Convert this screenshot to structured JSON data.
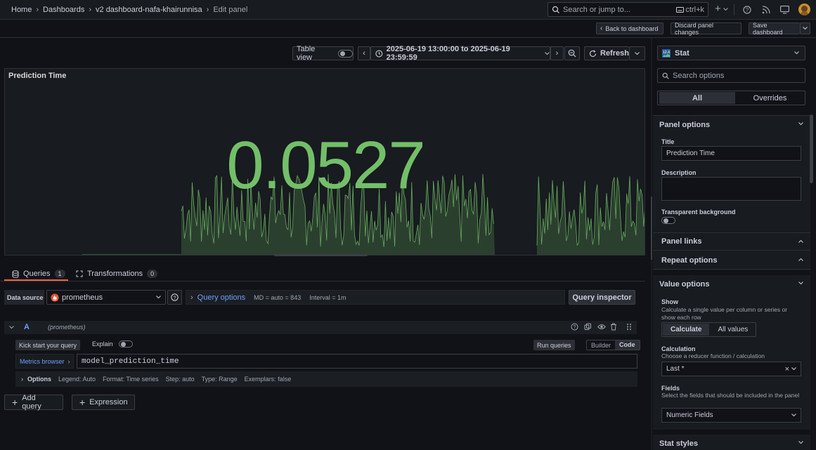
{
  "breadcrumbs": [
    "Home",
    "Dashboards",
    "v2 dashboard-nafa-khairunnisa",
    "Edit panel"
  ],
  "search": {
    "placeholder": "Search or jump to...",
    "shortcut": "ctrl+k"
  },
  "edit_toolbar": {
    "back": "Back to dashboard",
    "discard": "Discard panel changes",
    "save": "Save dashboard"
  },
  "panel_toolbar": {
    "table_view": "Table view",
    "time_range": "2025-06-19 13:00:00 to 2025-06-19 23:59:59",
    "refresh": "Refresh"
  },
  "panel": {
    "title": "Prediction Time",
    "value": "0.0527",
    "color": "#73bf69"
  },
  "query_tabs": [
    {
      "label": "Queries",
      "count": "1"
    },
    {
      "label": "Transformations",
      "count": "0"
    }
  ],
  "datasource": {
    "label": "Data source",
    "name": "prometheus",
    "query_options": "Query options",
    "md": "MD = auto = 843",
    "interval": "Interval = 1m",
    "inspector": "Query inspector"
  },
  "query": {
    "ref": "A",
    "ds": "(prometheus)",
    "kickstart": "Kick start your query",
    "explain": "Explain",
    "run": "Run queries",
    "builder": "Builder",
    "code": "Code",
    "metrics_browser": "Metrics browser",
    "expr": "model_prediction_time",
    "options": "Options",
    "legend": "Legend: Auto",
    "format": "Format: Time series",
    "step": "Step: auto",
    "type": "Type: Range",
    "exemplars": "Exemplars: false"
  },
  "add_buttons": {
    "add_query": "Add query",
    "expression": "Expression"
  },
  "right_pane": {
    "viz": "Stat",
    "search_placeholder": "Search options",
    "tabs": [
      "All",
      "Overrides"
    ],
    "sections": {
      "panel_options": "Panel options",
      "panel_links": "Panel links",
      "repeat_options": "Repeat options",
      "value_options": "Value options",
      "stat_styles": "Stat styles"
    },
    "title_label": "Title",
    "title_value": "Prediction Time",
    "description_label": "Description",
    "transparent_label": "Transparent background",
    "show_label": "Show",
    "show_desc": "Calculate a single value per column or series or show each row",
    "show_options": [
      "Calculate",
      "All values"
    ],
    "calc_label": "Calculation",
    "calc_desc": "Choose a reducer function / calculation",
    "calc_value": "Last *",
    "fields_label": "Fields",
    "fields_desc": "Select the fields that should be included in the panel",
    "fields_value": "Numeric Fields"
  }
}
